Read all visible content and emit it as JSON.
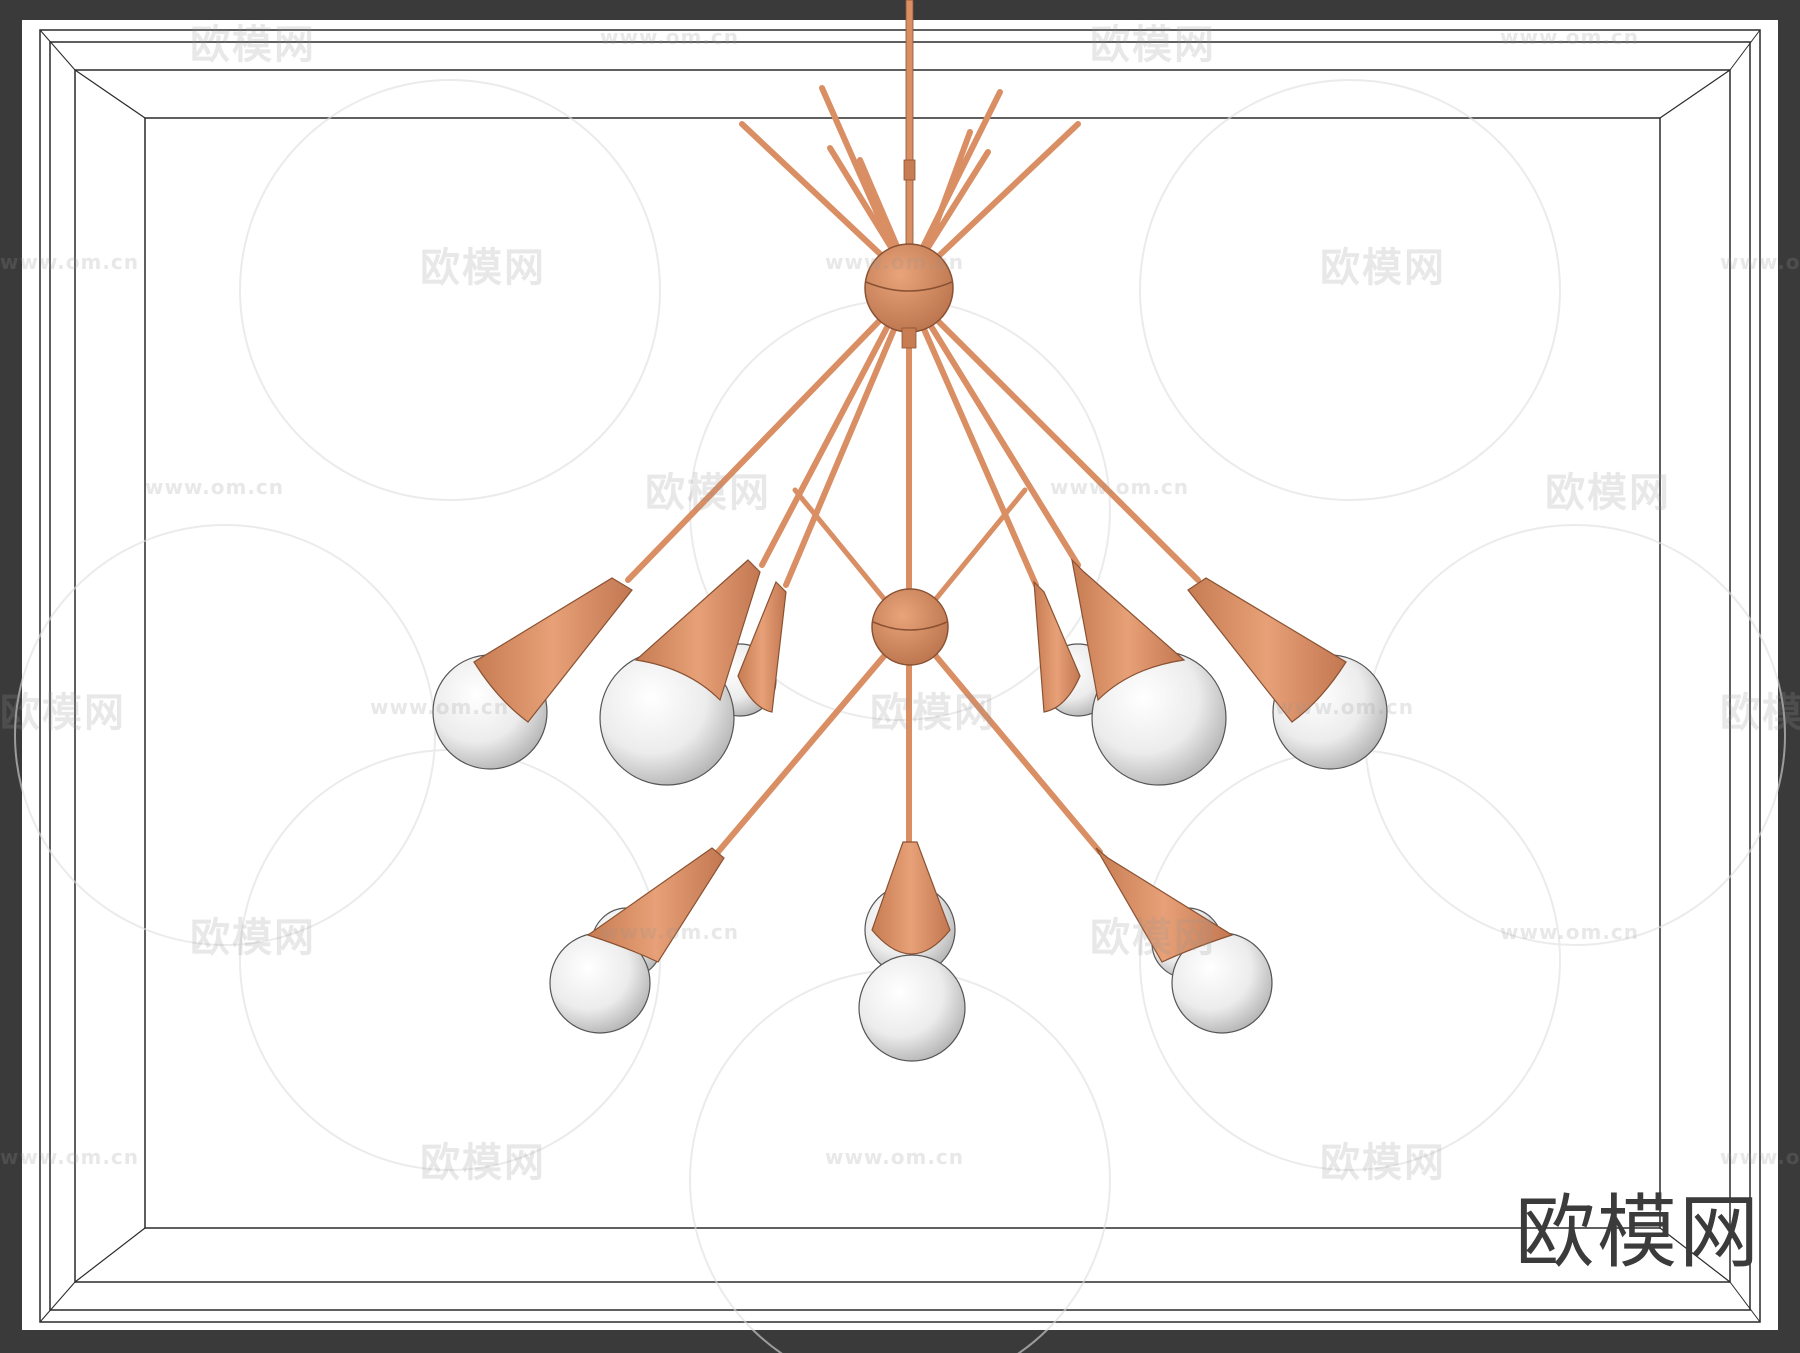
{
  "viewport": {
    "background_color": "#3a3a3a",
    "frame_color": "#ffffff",
    "frame_line_color": "#2a2a2a"
  },
  "model": {
    "metal_color": "#d98e63",
    "metal_shade_color": "#b8714a",
    "globe_color": "#f2f2f2",
    "globe_shade_color": "#b5b5b5",
    "upper_globe_count": 6,
    "lower_globe_count": 3
  },
  "watermark": {
    "brand_text": "欧模网",
    "url_text": "www.om.cn",
    "color": "#c8c8c8"
  }
}
